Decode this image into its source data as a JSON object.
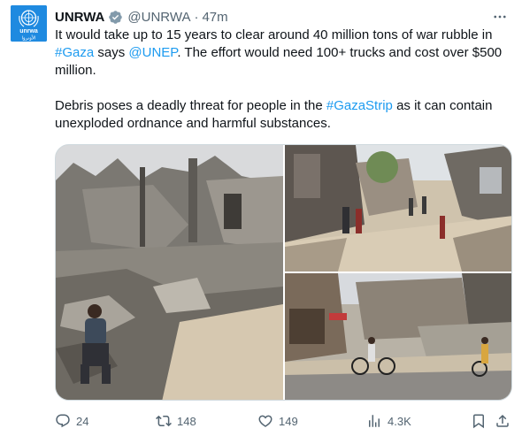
{
  "author": {
    "name": "UNRWA",
    "handle": "@UNRWA",
    "separator": "·",
    "time": "47m",
    "avatar_text": "unrwa",
    "avatar_text_ar": "الأونروا",
    "avatar_color": "#1f8ae0",
    "verified_color": "#829aab"
  },
  "tweet": {
    "p1": {
      "a": "It would take up to 15 years to clear around 40 million tons of war rubble in ",
      "b": "#Gaza",
      "c": " says ",
      "d": "@UNEP",
      "e": ". The effort would need 100+ trucks and cost over $500 million."
    },
    "p2": {
      "a": "Debris poses a deadly threat for people in the ",
      "b": "#GazaStrip",
      "c": " as it can contain unexploded ordnance and harmful substances."
    },
    "link_color": "#1d9bf0"
  },
  "media": {
    "images": [
      {
        "name": "rubble-man-photo",
        "subject": "man sitting on collapsed buildings rubble"
      },
      {
        "name": "street-debris-photo",
        "subject": "people walking down a debris-filled street"
      },
      {
        "name": "cyclists-rubble-photo",
        "subject": "children cycling past rubble"
      }
    ]
  },
  "actions": {
    "replies": "24",
    "reposts": "148",
    "likes": "149",
    "views": "4.3K"
  },
  "icons": {
    "reply": "reply-icon",
    "repost": "repost-icon",
    "like": "heart-icon",
    "views": "views-chart-icon",
    "bookmark": "bookmark-icon",
    "share": "share-icon",
    "more": "more-icon"
  }
}
